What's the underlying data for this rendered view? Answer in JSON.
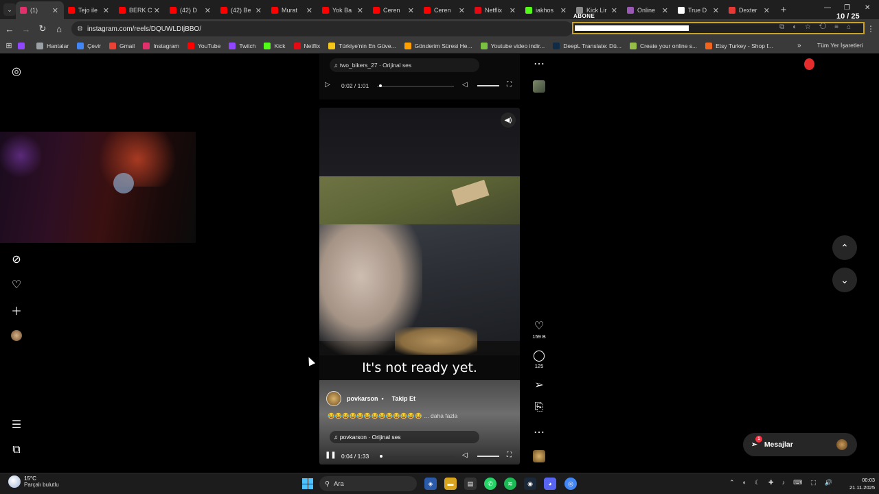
{
  "browser": {
    "tabs": [
      {
        "title": "(1)",
        "favicon_color": "#e1306c",
        "active": true
      },
      {
        "title": "Tejo ile",
        "favicon_color": "#ff0000"
      },
      {
        "title": "BERK C",
        "favicon_color": "#ff0000"
      },
      {
        "title": "(42) D",
        "favicon_color": "#ff0000"
      },
      {
        "title": "(42) Be",
        "favicon_color": "#ff0000"
      },
      {
        "title": "Murat",
        "favicon_color": "#ff0000"
      },
      {
        "title": "Yok Ba",
        "favicon_color": "#ff0000"
      },
      {
        "title": "Ceren",
        "favicon_color": "#ff0000"
      },
      {
        "title": "Ceren",
        "favicon_color": "#ff0000"
      },
      {
        "title": "Netflix",
        "favicon_color": "#e50914"
      },
      {
        "title": "iakhos",
        "favicon_color": "#53fc18"
      },
      {
        "title": "Kick Lir",
        "favicon_color": "#8a8a8a"
      },
      {
        "title": "Online",
        "favicon_color": "#9b59b6"
      },
      {
        "title": "True D",
        "favicon_color": "#ffffff"
      },
      {
        "title": "Dexter",
        "favicon_color": "#e53935"
      }
    ],
    "url": "instagram.com/reels/DQUWLDIjBBO/",
    "overlay_label": "ABONE",
    "overlay_counter": "10 / 25"
  },
  "bookmarks": [
    {
      "label": "Hantalar",
      "color": "#9aa0a6"
    },
    {
      "label": "Çevir",
      "color": "#4285f4"
    },
    {
      "label": "Gmail",
      "color": "#ea4335"
    },
    {
      "label": "Instagram",
      "color": "#e1306c"
    },
    {
      "label": "YouTube",
      "color": "#ff0000"
    },
    {
      "label": "Twitch",
      "color": "#9146ff"
    },
    {
      "label": "Kick",
      "color": "#53fc18"
    },
    {
      "label": "Netflix",
      "color": "#e50914"
    },
    {
      "label": "Türkiye'nin En Güve...",
      "color": "#f5c518"
    },
    {
      "label": "Gönderim Süresi He...",
      "color": "#ff9f00"
    },
    {
      "label": "Youtube video indir...",
      "color": "#7ac143"
    },
    {
      "label": "DeepL Translate: Dü...",
      "color": "#0f2b46"
    },
    {
      "label": "Create your online s...",
      "color": "#95bf47"
    },
    {
      "label": "Etsy Turkey - Shop f...",
      "color": "#f1641e"
    }
  ],
  "bookmarks_all": "Tüm Yer İşaretleri",
  "prev_reel": {
    "audio": "two_bikers_27 · Orijinal ses",
    "time": "0:02 / 1:01",
    "progress": 0.03
  },
  "reel": {
    "caption": "It's not ready yet.",
    "author": "povkarson",
    "follow_label": "Takip Et",
    "description_emojis": "😂😂😂😂😂😂😂😂😂😂😂😂😂",
    "more_label": "... daha fazla",
    "audio": "povkarson · Orijinal ses",
    "time": "0:04 / 1:33",
    "progress": 0.04
  },
  "actions": {
    "likes": "159 B",
    "comments": "125"
  },
  "messages": {
    "label": "Mesajlar",
    "badge": "1"
  },
  "taskbar": {
    "temp": "15°C",
    "weather": "Parçalı bulutlu",
    "search_placeholder": "Ara",
    "time": "00:03",
    "date": "21.11.2025"
  }
}
